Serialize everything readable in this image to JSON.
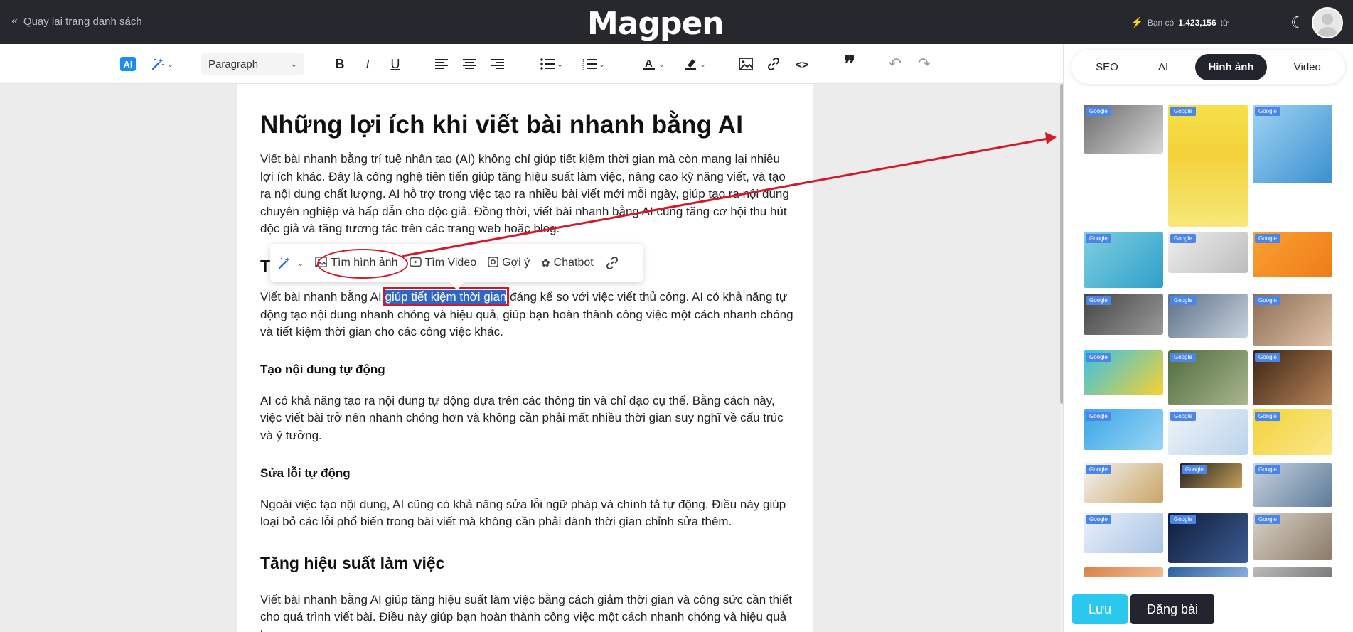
{
  "header": {
    "back_label": "Quay lại trang danh sách",
    "logo": "Magpen",
    "credits_prefix": "Bạn có",
    "credits_amount": "1,423,156",
    "credits_suffix": "từ"
  },
  "toolbar": {
    "ai_badge": "AI",
    "paragraph_select": "Paragraph"
  },
  "floating_toolbar": {
    "find_image": "Tìm hình ảnh",
    "find_video": "Tìm Video",
    "suggest": "Gợi ý",
    "chatbot": "Chatbot"
  },
  "document": {
    "title": "Những lợi ích khi viết bài nhanh bằng AI",
    "intro": "Viết bài nhanh bằng trí tuệ nhân tạo (AI) không chỉ giúp tiết kiệm thời gian mà còn mang lại nhiều lợi ích khác. Đây là công nghệ tiên tiến giúp tăng hiệu suất làm việc, nâng cao kỹ năng viết, và tạo ra nội dung chất lượng. AI hỗ trợ trong việc tạo ra nhiều bài viết mới mỗi ngày, giúp tạo ra nội dung chuyên nghiệp và hấp dẫn cho độc giả. Đồng thời, viết bài nhanh bằng AI cũng tăng cơ hội thu hút độc giả và tăng tương tác trên các trang web hoặc blog.",
    "section1_heading_visible": "T",
    "p2_before": "Viết bài nhanh bằng AI ",
    "p2_selected": "giúp tiết kiệm thời gian",
    "p2_after": " đáng kể so với việc viết thủ công. AI có khả năng tự động tạo nội dung nhanh chóng và hiệu quả, giúp bạn hoàn thành công việc một cách nhanh chóng và tiết kiệm thời gian cho các công việc khác.",
    "h3_auto_content": "Tạo nội dung tự động",
    "p3": "AI có khả năng tạo ra nội dung tự động dựa trên các thông tin và chỉ đạo cụ thể. Bằng cách này, việc viết bài trở nên nhanh chóng hơn và không cần phải mất nhiều thời gian suy nghĩ về cấu trúc và ý tưởng.",
    "h3_auto_fix": "Sửa lỗi tự động",
    "p4": "Ngoài việc tạo nội dung, AI cũng có khả năng sửa lỗi ngữ pháp và chính tả tự động. Điều này giúp loại bỏ các lỗi phổ biến trong bài viết mà không cần phải dành thời gian chỉnh sửa thêm.",
    "h2_performance": "Tăng hiệu suất làm việc",
    "p5": "Viết bài nhanh bằng AI giúp tăng hiệu suất làm việc bằng cách giảm thời gian và công sức cần thiết cho quá trình viết bài. Điều này giúp bạn hoàn thành công việc một cách nhanh chóng và hiệu quả hơn."
  },
  "right_panel": {
    "tabs": [
      "SEO",
      "AI",
      "Hình ảnh",
      "Video"
    ],
    "active_tab": "Hình ảnh",
    "image_source_tag": "Google",
    "save_label": "Lưu",
    "publish_label": "Đăng bài"
  },
  "colors": {
    "topbar": "#26282d",
    "accent": "#2bc8ee",
    "selection": "#2f66c6",
    "annotation": "#d11a2a"
  }
}
